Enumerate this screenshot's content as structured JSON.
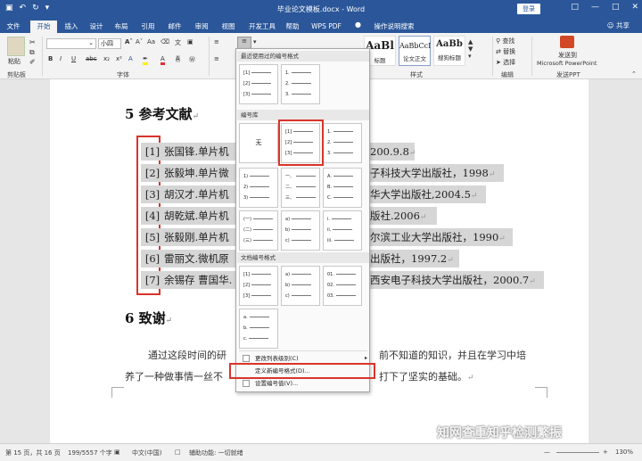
{
  "titlebar": {
    "title": "毕业论文模板.docx - Word",
    "login": "登录",
    "save_icon": "save-icon",
    "undo_icon": "undo-icon",
    "redo_icon": "redo-icon"
  },
  "tabs": [
    "文件",
    "开始",
    "插入",
    "设计",
    "布局",
    "引用",
    "邮件",
    "审阅",
    "视图",
    "开发工具",
    "帮助",
    "WPS PDF",
    "操作说明搜索"
  ],
  "share": "共享",
  "ribbon": {
    "clipboard": {
      "paste": "粘贴",
      "label": "剪贴板"
    },
    "font": {
      "name": "",
      "size": "小四",
      "label": "字体"
    },
    "styles": {
      "tiles": [
        {
          "sample": "AaBl",
          "name": "标题"
        },
        {
          "sample": "AaBbCcI",
          "name": "论文正文"
        },
        {
          "sample": "AaBb",
          "name": "搜狗标题"
        }
      ],
      "label": "样式"
    },
    "editing": {
      "find": "查找",
      "replace": "替换",
      "select": "选择",
      "label": "编辑"
    },
    "sendppt": {
      "line1": "发送到",
      "line2": "Microsoft PowerPoint",
      "label": "发送PPT"
    }
  },
  "document": {
    "heading5": "5   参考文献",
    "refs": [
      {
        "num": "[1]",
        "text": "张国锋.单片机原",
        "tail": "200.9.8"
      },
      {
        "num": "[2]",
        "text": "张毅坤.单片微型",
        "tail": "子科技大学出版社，1998"
      },
      {
        "num": "[3]",
        "text": "胡汉才.单片机原",
        "tail": "华大学出版社,2004.5"
      },
      {
        "num": "[4]",
        "text": "胡乾斌.单片机原",
        "tail": "版社.2006"
      },
      {
        "num": "[5]",
        "text": "张毅刚.单片机原",
        "tail": "尔滨工业大学出版社，1990"
      },
      {
        "num": "[6]",
        "text": "雷丽文.微机原理",
        "tail": "出版社，1997.2"
      },
      {
        "num": "[7]",
        "text": "余锡存 曹国华.",
        "tail": "西安电子科技大学出版社，2000.7"
      }
    ],
    "heading6": "6   致谢",
    "para1_left": "通过这段时间的研",
    "para1_right": "前不知道的知识，并且在学习中培",
    "para2_left": "养了一种做事情一丝不",
    "para2_right": "打下了坚实的基础。"
  },
  "dropdown": {
    "recent_header": "最近使用过的编号格式",
    "library_header": "编号库",
    "doc_header": "文档编号格式",
    "none_label": "无",
    "formats": {
      "bracket": [
        "[1]",
        "[2]",
        "[3]"
      ],
      "dot": [
        "1.",
        "2.",
        "3."
      ],
      "paren": [
        "1)",
        "2)",
        "3)"
      ],
      "cjk": [
        "一、",
        "二、",
        "三、"
      ],
      "alpha_upper": [
        "A.",
        "B.",
        "C."
      ],
      "cjk_paren": [
        "(一)",
        "(二)",
        "(三)"
      ],
      "alpha_paren": [
        "a)",
        "b)",
        "c)"
      ],
      "roman": [
        "i.",
        "ii.",
        "iii."
      ],
      "zero": [
        "01.",
        "02.",
        "03."
      ],
      "alpha_lower": [
        "a.",
        "b.",
        "c."
      ]
    },
    "menu": [
      "更改列表级别(C)",
      "定义新编号格式(D)...",
      "设置编号值(V)..."
    ]
  },
  "statusbar": {
    "page": "第 15 页，共 16 页",
    "words": "199/5557 个字",
    "lang": "中文(中国)",
    "access": "辅助功能: 一切就绪",
    "zoom": "130%"
  },
  "watermark": "知网查重知乎检测繁振"
}
